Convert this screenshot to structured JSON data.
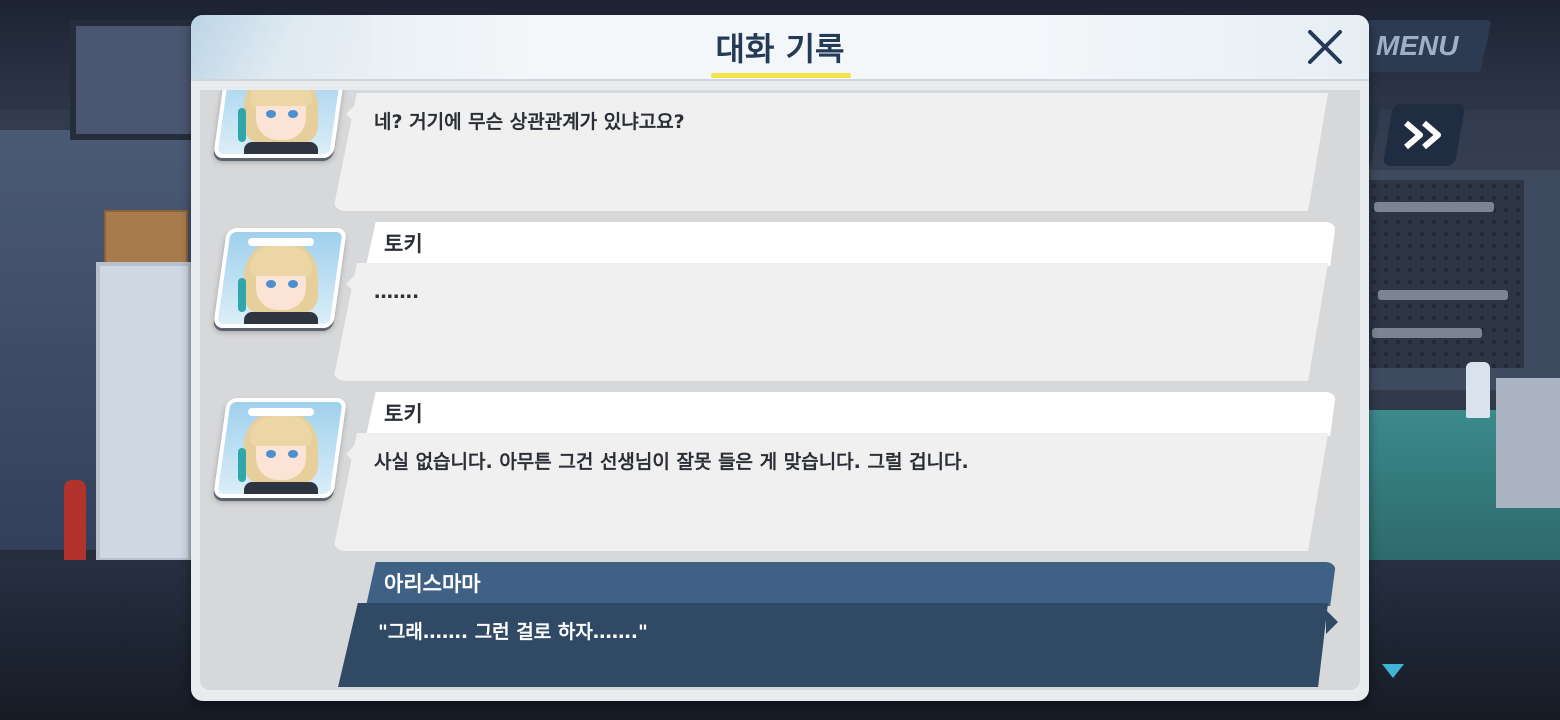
{
  "dialog": {
    "title": "대화 기록"
  },
  "hud": {
    "menu_label": "MENU"
  },
  "log": [
    {
      "speaker": "",
      "text": "네? 거기에 무슨 상관관계가 있냐고요?"
    },
    {
      "speaker": "토키",
      "text": "……."
    },
    {
      "speaker": "토키",
      "text": "사실 없습니다. 아무튼 그건 선생님이 잘못 들은 게 맞습니다. 그럴 겁니다."
    }
  ],
  "player_entry": {
    "speaker": "아리스마마",
    "text": "\"그래……. 그런 걸로 하자…….\""
  },
  "colors": {
    "title": "#243a57",
    "title_underline": "#f2e34a",
    "player_name_bg": "#3f6186",
    "player_text_bg": "#304a66",
    "npc_text_bg": "#f0f0f0"
  }
}
